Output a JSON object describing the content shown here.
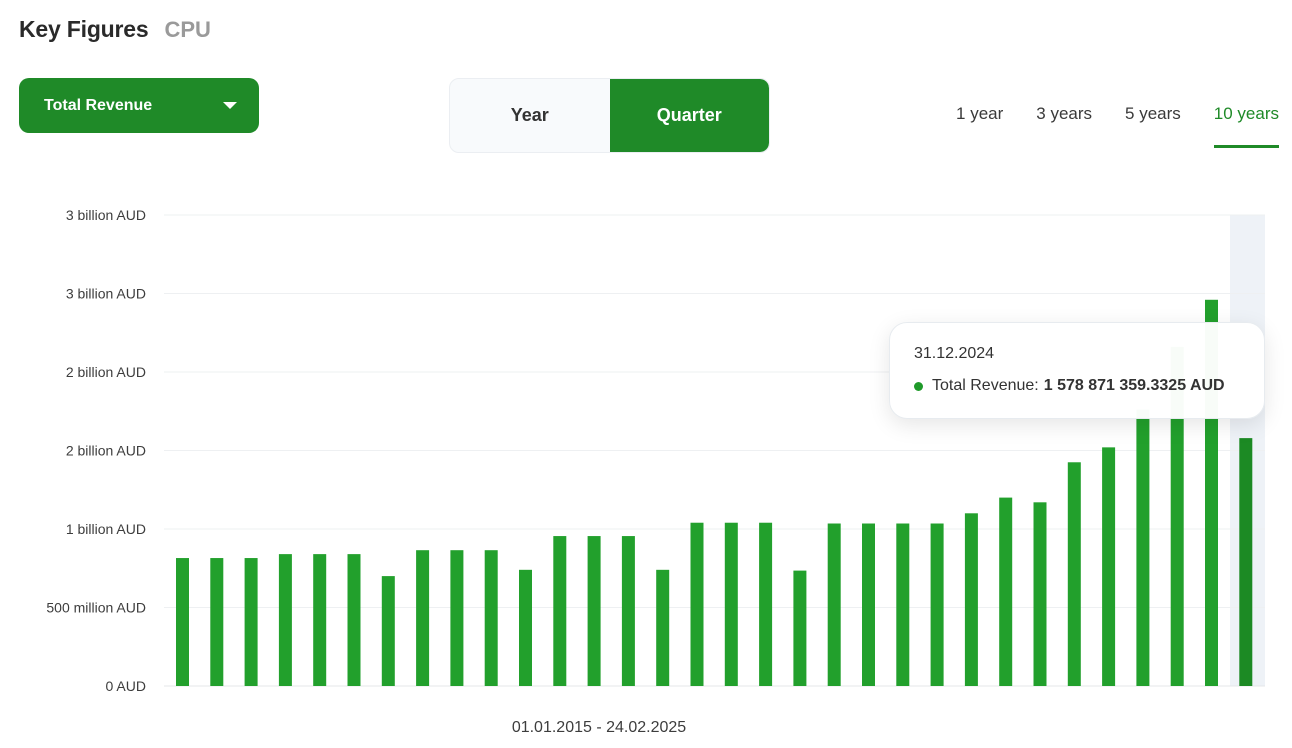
{
  "header": {
    "title": "Key Figures",
    "ticker": "CPU"
  },
  "metric_dropdown": {
    "selected": "Total Revenue"
  },
  "period_toggle": {
    "options": [
      "Year",
      "Quarter"
    ],
    "active": "Quarter"
  },
  "range_tabs": {
    "options": [
      "1 year",
      "3 years",
      "5 years",
      "10 years"
    ],
    "active": "10 years"
  },
  "colors": {
    "accent": "#1f8a28",
    "bar": "#22a02c",
    "bar_highlight": "#1c8a24"
  },
  "tooltip": {
    "date": "31.12.2024",
    "series_label": "Total Revenue:",
    "value": "1 578 871 359.3325 AUD"
  },
  "chart_data": {
    "type": "bar",
    "date_range_label": "01.01.2015 - 24.02.2025",
    "y_tick_labels": [
      "0 AUD",
      "500 million AUD",
      "1 billion AUD",
      "2 billion AUD",
      "2 billion AUD",
      "3 billion AUD",
      "3 billion AUD"
    ],
    "ylim": [
      0,
      3000000000
    ],
    "y_ticks": [
      0,
      500000000,
      1000000000,
      1500000000,
      2000000000,
      2500000000,
      3000000000
    ],
    "grid": true,
    "legend": "none",
    "series": [
      {
        "name": "Total Revenue",
        "values": [
          815000000,
          815000000,
          815000000,
          840000000,
          840000000,
          840000000,
          700000000,
          865000000,
          865000000,
          865000000,
          740000000,
          955000000,
          955000000,
          955000000,
          740000000,
          1040000000,
          1040000000,
          1040000000,
          735000000,
          1035000000,
          1035000000,
          1035000000,
          1035000000,
          1100000000,
          1200000000,
          1170000000,
          1425000000,
          1520000000,
          1760000000,
          2160000000,
          2460000000,
          1578871359
        ]
      }
    ],
    "highlighted_index": 31
  }
}
